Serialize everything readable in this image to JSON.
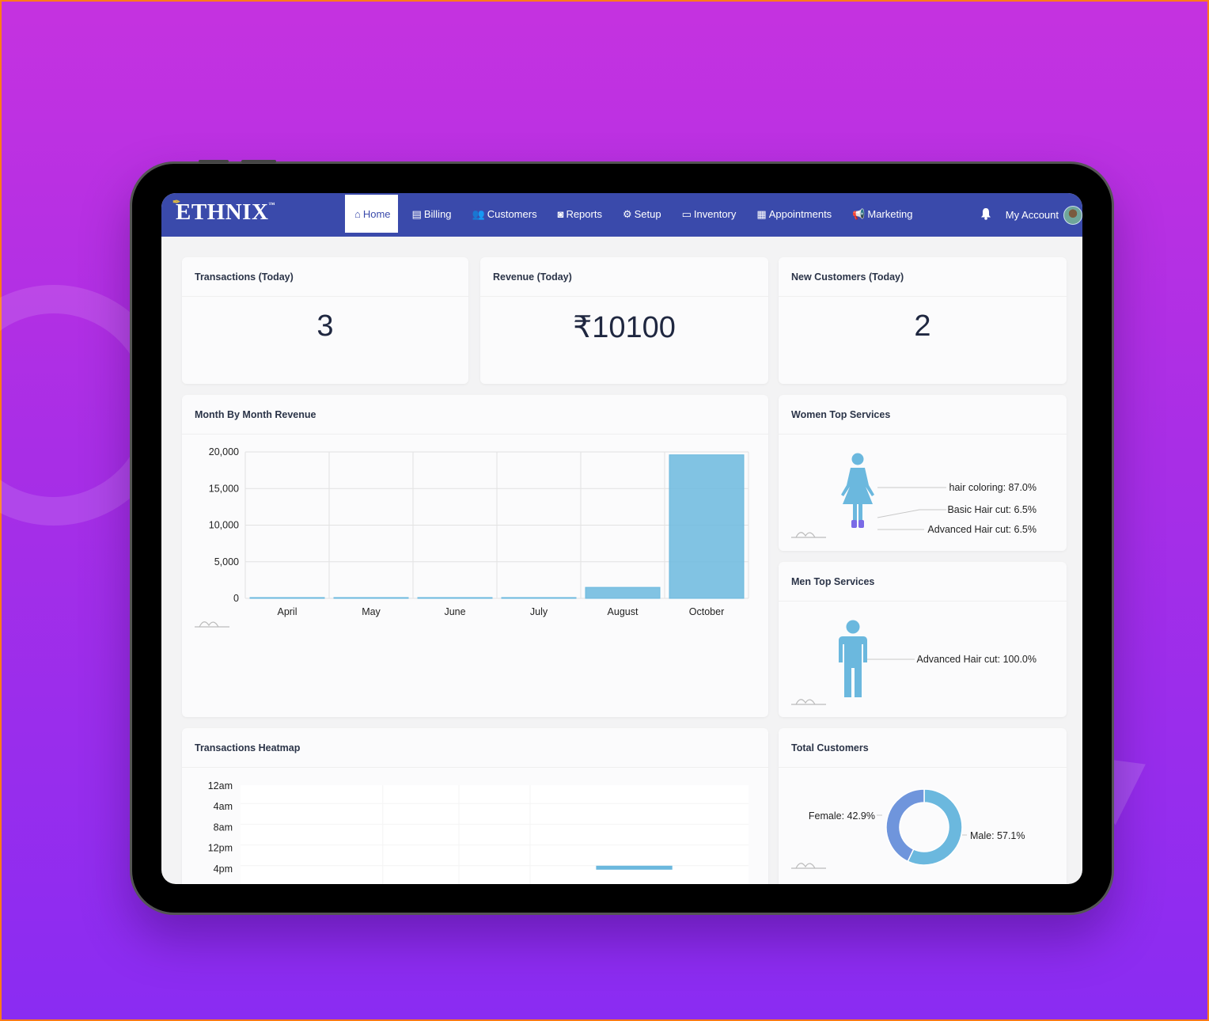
{
  "app": {
    "logo_text": "ETHNIX",
    "logo_tm": "™",
    "brand_color": "#3a4aab"
  },
  "nav": {
    "items": [
      {
        "label": "Home",
        "icon": "home-icon",
        "glyph": "⌂",
        "active": true
      },
      {
        "label": "Billing",
        "icon": "cash-register-icon",
        "glyph": "▤",
        "active": false
      },
      {
        "label": "Customers",
        "icon": "users-icon",
        "glyph": "👥",
        "active": false
      },
      {
        "label": "Reports",
        "icon": "report-search-icon",
        "glyph": "◙",
        "active": false
      },
      {
        "label": "Setup",
        "icon": "gear-icon",
        "glyph": "⚙",
        "active": false
      },
      {
        "label": "Inventory",
        "icon": "store-icon",
        "glyph": "▭",
        "active": false
      },
      {
        "label": "Appointments",
        "icon": "calendar-icon",
        "glyph": "▦",
        "active": false
      },
      {
        "label": "Marketing",
        "icon": "megaphone-icon",
        "glyph": "📢",
        "active": false
      }
    ],
    "account_label": "My Account",
    "bell_glyph": "🔔"
  },
  "stats": [
    {
      "title": "Transactions (Today)",
      "value": "3"
    },
    {
      "title": "Revenue (Today)",
      "value": "₹10100"
    },
    {
      "title": "New Customers (Today)",
      "value": "2"
    }
  ],
  "revenue_card": {
    "title": "Month By Month Revenue"
  },
  "women_card": {
    "title": "Women Top Services"
  },
  "men_card": {
    "title": "Men Top Services"
  },
  "heatmap_card": {
    "title": "Transactions Heatmap"
  },
  "customers_card": {
    "title": "Total Customers"
  },
  "chart_data": [
    {
      "type": "bar",
      "title": "Month By Month Revenue",
      "categories": [
        "April",
        "May",
        "June",
        "July",
        "August",
        "October"
      ],
      "values": [
        0,
        0,
        0,
        0,
        1500,
        19600
      ],
      "ylim": [
        0,
        20000
      ],
      "yticks": [
        0,
        5000,
        10000,
        15000,
        20000
      ],
      "ytick_labels": [
        "0",
        "5,000",
        "10,000",
        "15,000",
        "20,000"
      ],
      "xlabel": "",
      "ylabel": "",
      "grid": true,
      "color": "#6bb8de"
    },
    {
      "type": "pie",
      "title": "Women Top Services",
      "labels": [
        "hair coloring",
        "Basic Hair cut",
        "Advanced Hair cut"
      ],
      "values": [
        87.0,
        6.5,
        6.5
      ],
      "label_texts": [
        "hair coloring: 87.0%",
        "Basic Hair cut: 6.5%",
        "Advanced Hair cut: 6.5%"
      ],
      "colors": [
        "#6bb8de",
        "#6f8fe0",
        "#7a6ae6"
      ]
    },
    {
      "type": "pie",
      "title": "Men Top Services",
      "labels": [
        "Advanced Hair cut"
      ],
      "values": [
        100.0
      ],
      "label_texts": [
        "Advanced Hair cut: 100.0%"
      ],
      "colors": [
        "#6bb8de"
      ]
    },
    {
      "type": "heatmap",
      "title": "Transactions Heatmap",
      "y_labels": [
        "12am",
        "4am",
        "8am",
        "12pm",
        "4pm"
      ],
      "cells": [
        {
          "row": "4pm",
          "col_fraction_start": 0.7,
          "col_fraction_end": 0.85,
          "value": 1
        }
      ],
      "color": "#6bb8de"
    },
    {
      "type": "pie",
      "title": "Total Customers",
      "labels": [
        "Female",
        "Male"
      ],
      "values": [
        42.9,
        57.1
      ],
      "label_texts": [
        "Female: 42.9%",
        "Male: 57.1%"
      ],
      "colors": [
        "#6f95dc",
        "#6bb8de"
      ],
      "donut": true
    }
  ]
}
